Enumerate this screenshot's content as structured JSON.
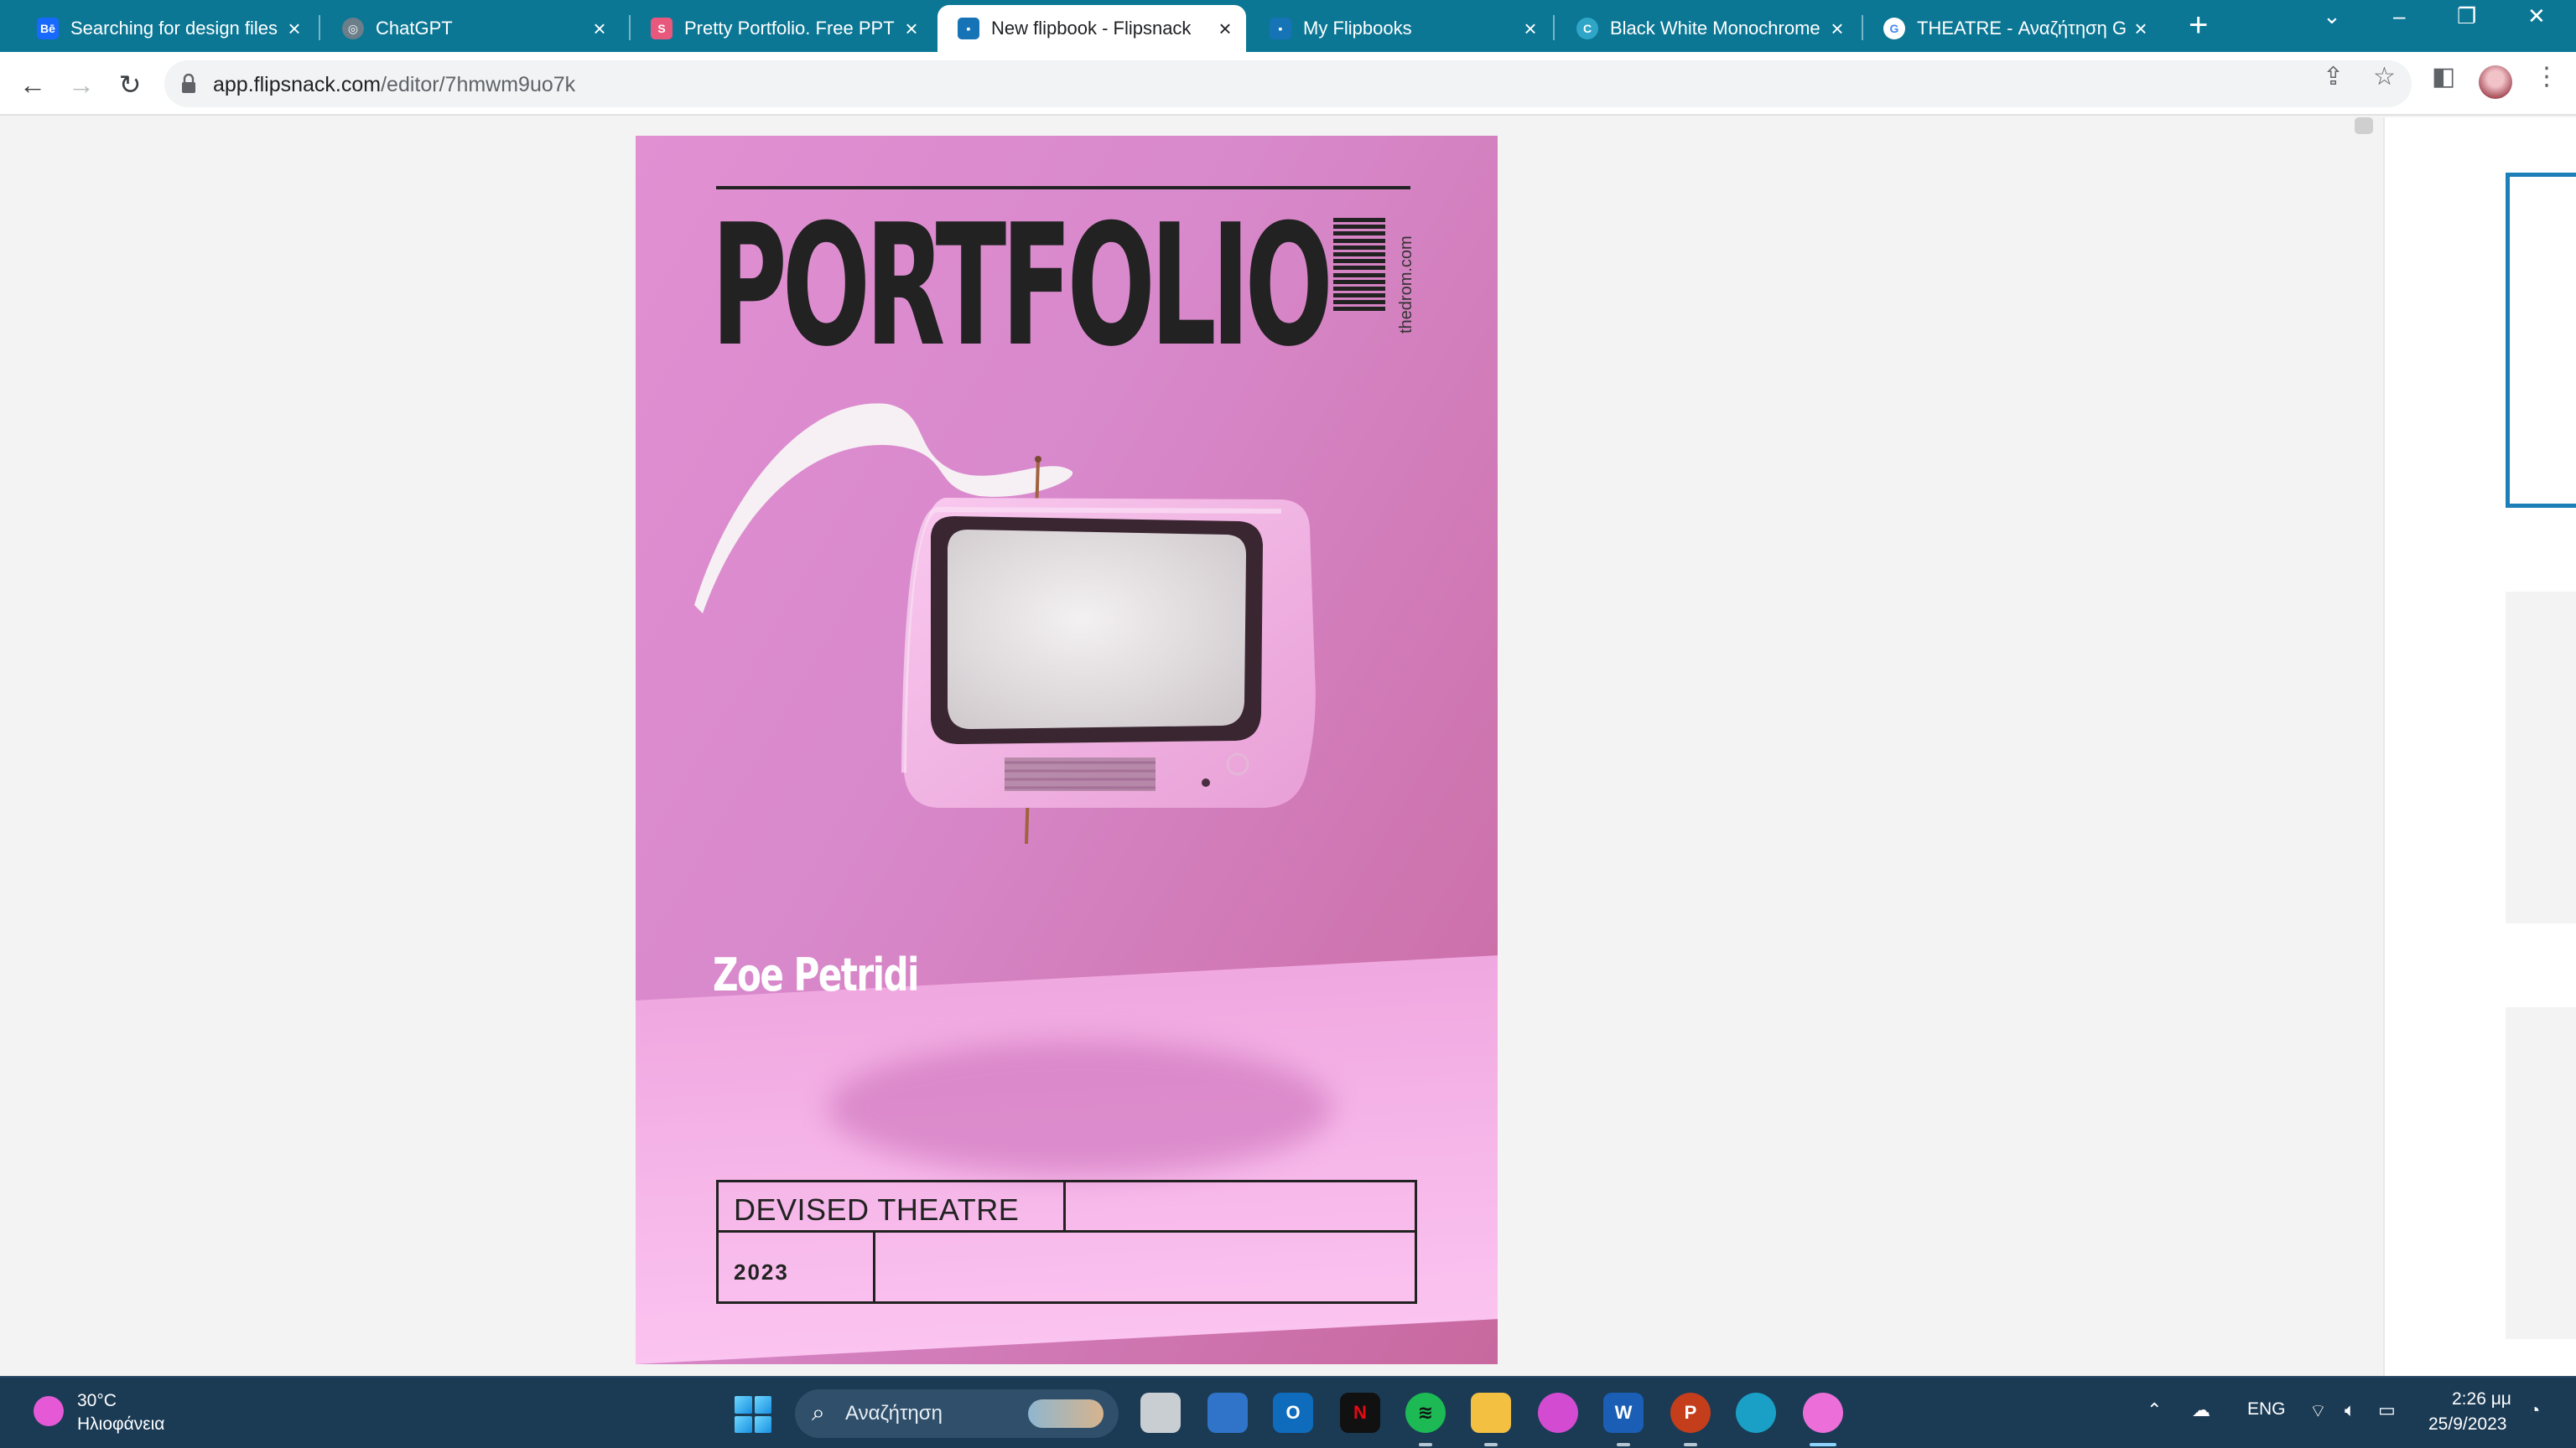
{
  "browser": {
    "tabs": [
      {
        "title": "Searching for design files",
        "favicon": "behance-icon",
        "favicon_text": "Bē",
        "favicon_color": "#1769ff"
      },
      {
        "title": "ChatGPT",
        "favicon": "chatgpt-icon",
        "favicon_text": "◎",
        "favicon_color": "#6b7e8a"
      },
      {
        "title": "Pretty Portfolio. Free PPT",
        "favicon": "slidesgo-icon",
        "favicon_text": "S",
        "favicon_color": "#e8577c"
      },
      {
        "title": "New flipbook - Flipsnack",
        "favicon": "flipsnack-icon",
        "favicon_text": "▪",
        "favicon_color": "#1573b6",
        "active": true
      },
      {
        "title": "My Flipbooks",
        "favicon": "flipsnack-icon",
        "favicon_text": "▪",
        "favicon_color": "#1573b6"
      },
      {
        "title": "Black White Monochrome",
        "favicon": "canva-icon",
        "favicon_text": "C",
        "favicon_color": "#2fa6c7"
      },
      {
        "title": "THEATRE - Αναζήτηση Google",
        "favicon": "google-icon",
        "favicon_text": "G",
        "favicon_color": "#4285f4"
      }
    ],
    "new_tab_glyph": "+",
    "window_controls": {
      "tabsearch": "⌄",
      "minimize": "–",
      "restore": "❐",
      "close": "✕"
    },
    "url_domain": "app.flipsnack.com",
    "url_path": "/editor/7hmwm9uo7k"
  },
  "page": {
    "title": "PORTFOLIO",
    "site": "thedrom.com",
    "author": "Zoe Petridi",
    "category": "DEVISED THEATRE",
    "year": "2023",
    "colors": {
      "background": "#d889cb",
      "text": "#222222"
    }
  },
  "taskbar": {
    "weather_temp": "30°C",
    "weather_desc": "Ηλιοφάνεια",
    "search_placeholder": "Αναζήτηση",
    "language": "ENG",
    "time": "2:26 μμ",
    "date": "25/9/2023",
    "apps": [
      {
        "name": "file-viewer-icon",
        "label": "",
        "color": "#c9ced3"
      },
      {
        "name": "teams-meet-icon",
        "label": "",
        "color": "#2f74c9"
      },
      {
        "name": "outlook-icon",
        "label": "O",
        "color": "#0f6cbd"
      },
      {
        "name": "netflix-icon",
        "label": "N",
        "color": "#111111"
      },
      {
        "name": "spotify-icon",
        "label": "≋",
        "color": "#1db954"
      },
      {
        "name": "file-explorer-icon",
        "label": "",
        "color": "#f3c042"
      },
      {
        "name": "chrome-alt-icon",
        "label": "",
        "color": "#d24bd1"
      },
      {
        "name": "word-icon",
        "label": "W",
        "color": "#1b5eb6"
      },
      {
        "name": "powerpoint-icon",
        "label": "P",
        "color": "#c43e1c"
      },
      {
        "name": "edge-icon",
        "label": "",
        "color": "#1aa0c6"
      },
      {
        "name": "chrome-profile-icon",
        "label": "",
        "color": "#ec6fd9"
      }
    ]
  }
}
